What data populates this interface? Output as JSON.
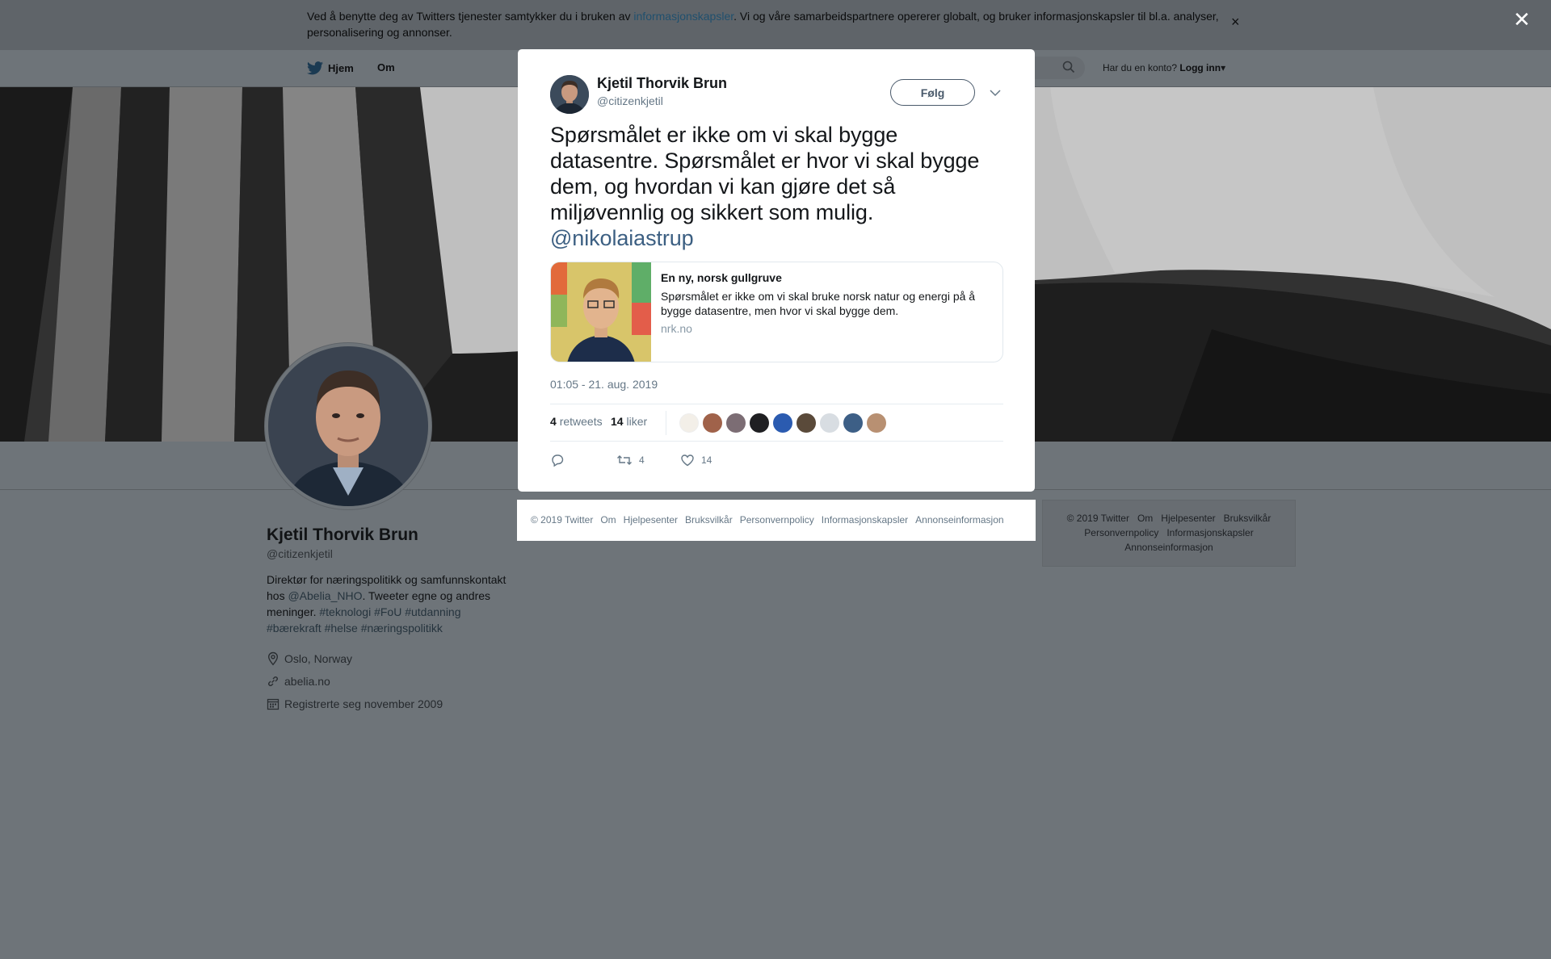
{
  "cookie_banner": {
    "text_before": "Ved å benytte deg av Twitters tjenester samtykker du i bruken av ",
    "link": "informasjonskapsler",
    "text_after": ". Vi og våre samarbeidspartnere opererer globalt, og bruker informasjonskapsler til bl.a. analyser, personalisering og annonser.",
    "close": "×"
  },
  "nav": {
    "home": "Hjem",
    "about": "Om",
    "account_prompt": "Har du en konto?",
    "login": "Logg inn"
  },
  "overlay_close": "✕",
  "tweet": {
    "author_name": "Kjetil Thorvik Brun",
    "author_handle": "@citizenkjetil",
    "follow_label": "Følg",
    "text": "Spørsmålet er ikke om vi skal bygge datasentre. Spørsmålet er hvor vi skal bygge dem, og hvordan vi kan gjøre det så miljøvennlig og sikkert som mulig.",
    "mention": "@nikolaiastrup",
    "card": {
      "title": "En ny, norsk gullgruve",
      "description": "Spørsmålet er ikke om vi skal bruke norsk natur og energi på å bygge datasentre, men hvor vi skal bygge dem.",
      "domain": "nrk.no"
    },
    "timestamp": "01:05 - 21. aug. 2019",
    "retweets_count": "4",
    "retweets_label": "retweets",
    "likes_count": "14",
    "likes_label": "liker",
    "action_retweets": "4",
    "action_likes": "14"
  },
  "modal_footer": [
    "© 2019 Twitter",
    "Om",
    "Hjelpesenter",
    "Bruksvilkår",
    "Personvernpolicy",
    "Informasjonskapsler",
    "Annonseinformasjon"
  ],
  "profile": {
    "name": "Kjetil Thorvik Brun",
    "handle": "@citizenkjetil",
    "bio_1": "Direktør for næringspolitikk og samfunnskontakt hos ",
    "bio_mention": "@Abelia_NHO",
    "bio_2": ". Tweeter egne og andres meninger. ",
    "bio_tags": "#teknologi #FoU #utdanning #bærekraft #helse #næringspolitikk",
    "location": "Oslo, Norway",
    "website": "abelia.no",
    "joined": "Registrerte seg november 2009"
  },
  "side_footer": {
    "line1": [
      "© 2019 Twitter",
      "Om",
      "Hjelpesenter",
      "Bruksvilkår"
    ],
    "line2": [
      "Personvernpolicy",
      "Informasjonskapsler"
    ],
    "line3": [
      "Annonseinformasjon"
    ]
  },
  "colors": {
    "dim_background": "#6e7479",
    "modal_bg": "#ffffff",
    "mention": "#3c5f82",
    "muted": "#657786"
  },
  "icons": [
    "twitter-bird-icon",
    "search-icon",
    "close-icon",
    "chevron-down-icon",
    "reply-icon",
    "retweet-icon",
    "heart-icon",
    "location-icon",
    "link-icon",
    "calendar-icon"
  ]
}
